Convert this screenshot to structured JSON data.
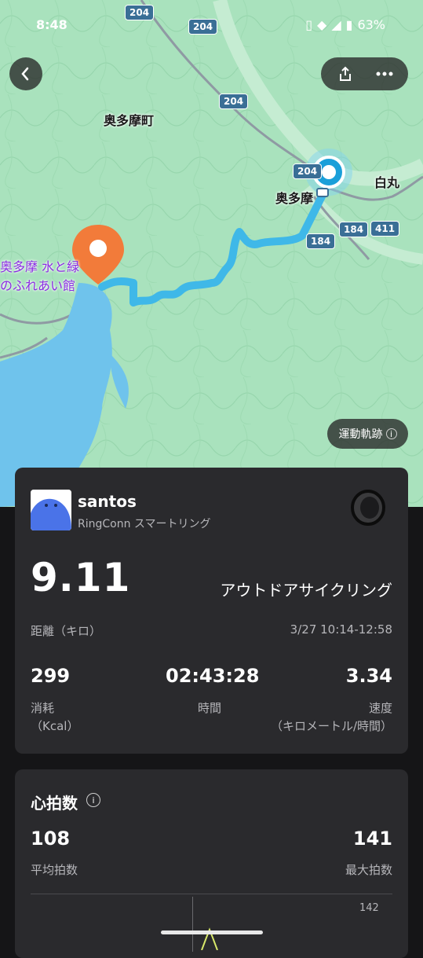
{
  "status_bar": {
    "time": "8:48",
    "battery": "63%"
  },
  "map": {
    "labels": {
      "town": "奥多摩町",
      "station": "奥多摩",
      "shiromaru": "白丸",
      "poi_line1": "奥多摩 水と緑",
      "poi_line2": "のふれあい館"
    },
    "roads": {
      "r204a": "204",
      "r204b": "204",
      "r204c": "204",
      "r204d": "204",
      "r184a": "184",
      "r184b": "184",
      "r411": "411"
    },
    "track_button_label": "運動軌跡",
    "route_color": "#3fb8e8"
  },
  "summary": {
    "user_name": "santos",
    "device": "RingConn スマートリング",
    "distance_value": "9.11",
    "distance_label": "距離（キロ）",
    "activity": "アウトドアサイクリング",
    "datetime": "3/27 10:14-12:58",
    "calories_value": "299",
    "calories_label": "消耗",
    "calories_unit": "（Kcal）",
    "duration_value": "02:43:28",
    "duration_label": "時間",
    "speed_value": "3.34",
    "speed_label": "速度",
    "speed_unit": "（キロメートル/時間）"
  },
  "heart_rate": {
    "title": "心拍数",
    "avg_value": "108",
    "avg_label": "平均拍数",
    "max_value": "141",
    "max_label": "最大拍数",
    "chart_top_tick": "142"
  }
}
